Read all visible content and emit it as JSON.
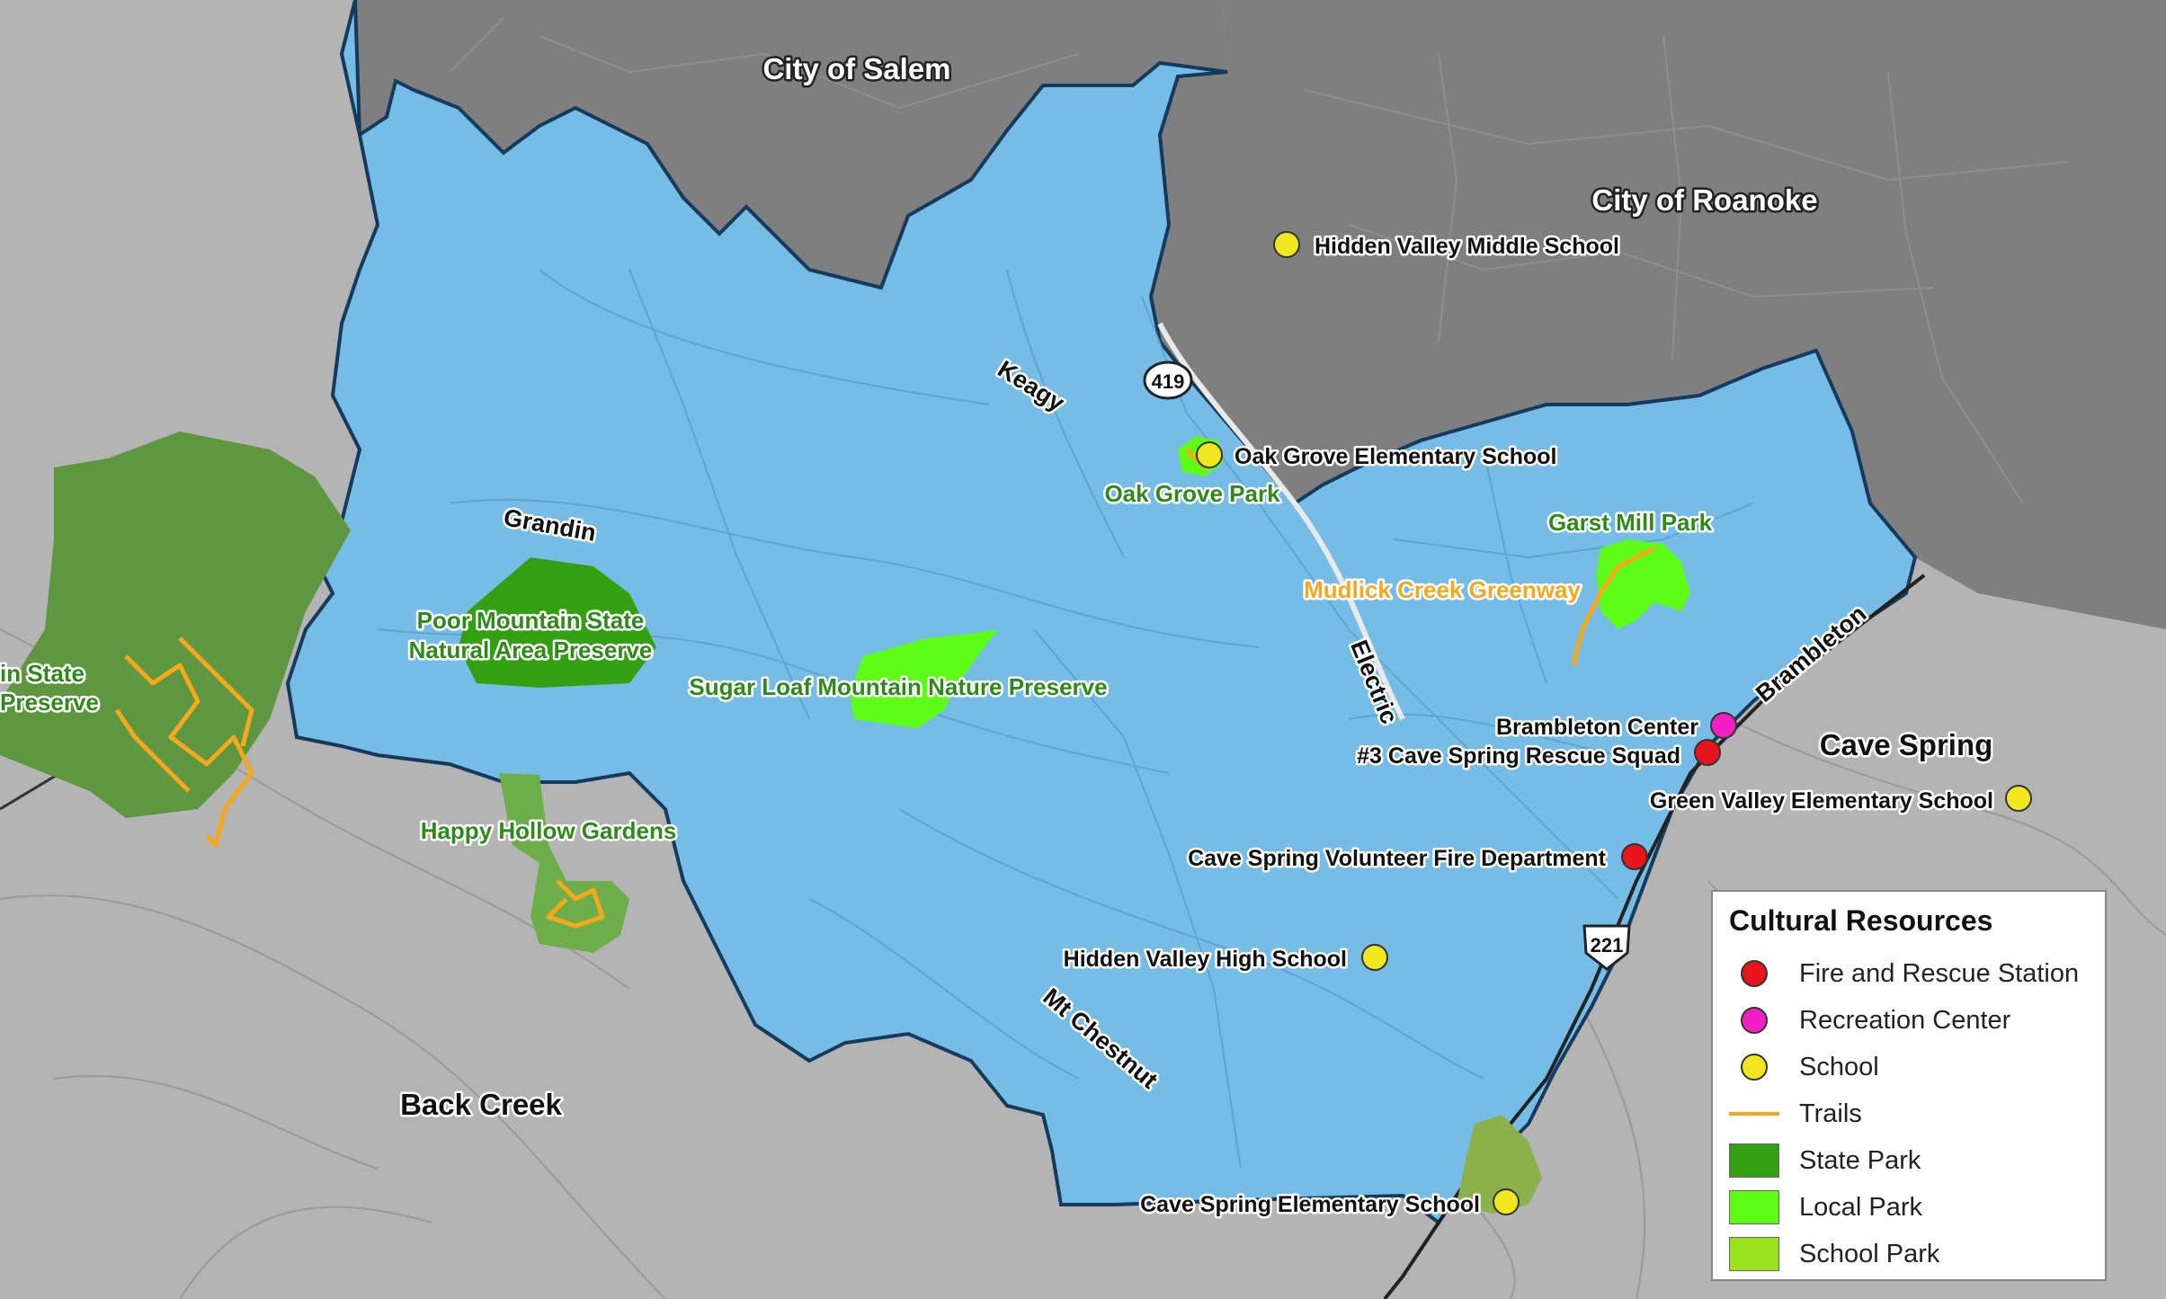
{
  "place_labels": {
    "city_of_salem": "City of Salem",
    "city_of_roanoke": "City of Roanoke",
    "cave_spring": "Cave Spring",
    "back_creek": "Back Creek",
    "poor_mountain_cut": "in State Preserve"
  },
  "road_labels": {
    "keagy": "Keagy",
    "grandin": "Grandin",
    "electric": "Electric",
    "brambleton": "Brambleton",
    "mt_chestnut": "Mt Chestnut",
    "route_419": "419",
    "route_221": "221"
  },
  "park_labels": {
    "oak_grove_park": "Oak Grove Park",
    "garst_mill_park": "Garst Mill Park",
    "poor_mountain_line1": "Poor Mountain State",
    "poor_mountain_line2": "Natural Area Preserve",
    "sugar_loaf": "Sugar Loaf Mountain Nature Preserve",
    "happy_hollow": "Happy Hollow Gardens",
    "cut_line1": "in State",
    "cut_line2": "Preserve"
  },
  "trail_labels": {
    "mudlick_creek": "Mudlick Creek Greenway"
  },
  "poi": {
    "hidden_valley_middle": "Hidden Valley Middle School",
    "oak_grove_elementary": "Oak Grove Elementary School",
    "brambleton_center": "Brambleton Center",
    "cave_spring_rescue": "#3 Cave Spring Rescue Squad",
    "green_valley_elementary": "Green Valley Elementary School",
    "cave_spring_fire": "Cave Spring Volunteer Fire Department",
    "hidden_valley_high": "Hidden Valley High School",
    "cave_spring_elementary": "Cave Spring Elementary School"
  },
  "legend": {
    "title": "Cultural Resources",
    "items": [
      {
        "label": "Fire and Rescue Station",
        "symbol": "circle",
        "color": "#e8141c"
      },
      {
        "label": "Recreation Center",
        "symbol": "circle",
        "color": "#f21fc4"
      },
      {
        "label": "School",
        "symbol": "circle",
        "color": "#f2e61e"
      },
      {
        "label": "Trails",
        "symbol": "line",
        "color": "#f5a81c"
      },
      {
        "label": "State Park",
        "symbol": "fill",
        "color": "#33a012"
      },
      {
        "label": "Local Park",
        "symbol": "fill",
        "color": "#5dfc15"
      },
      {
        "label": "School Park",
        "symbol": "fill",
        "color": "#9be21e"
      }
    ]
  },
  "colors": {
    "district": "#75bde7",
    "district_outline": "#163a5c",
    "county_background": "#b4b4b4",
    "city_area": "#7f7f7f",
    "state_park": "#33a012",
    "state_park_outside": "#5f9640",
    "local_park": "#5dfc15",
    "school_park": "#9be21e",
    "trail": "#f5a81c",
    "fire_rescue": "#e8141c",
    "recreation": "#f21fc4",
    "school": "#f2e61e"
  }
}
